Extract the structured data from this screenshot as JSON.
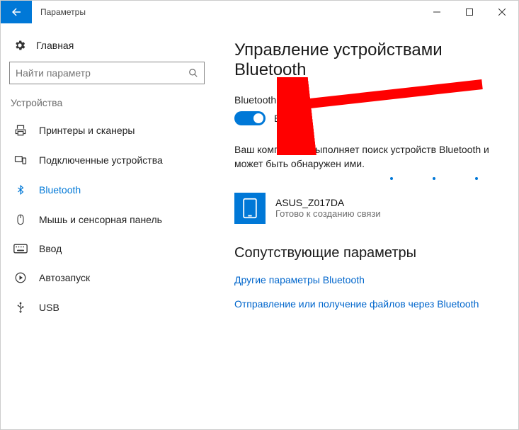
{
  "titlebar": {
    "title": "Параметры"
  },
  "sidebar": {
    "home": "Главная",
    "search_placeholder": "Найти параметр",
    "group": "Устройства",
    "items": [
      {
        "label": "Принтеры и сканеры"
      },
      {
        "label": "Подключенные устройства"
      },
      {
        "label": "Bluetooth"
      },
      {
        "label": "Мышь и сенсорная панель"
      },
      {
        "label": "Ввод"
      },
      {
        "label": "Автозапуск"
      },
      {
        "label": "USB"
      }
    ]
  },
  "main": {
    "heading": "Управление устройствами Bluetooth",
    "bt_label": "Bluetooth",
    "toggle_state_label": "Вкл.",
    "description": "Ваш компьютер выполняет поиск устройств Bluetooth и может быть обнаружен ими.",
    "device": {
      "name": "ASUS_Z017DA",
      "status": "Готово к созданию связи"
    },
    "related_heading": "Сопутствующие параметры",
    "link1": "Другие параметры Bluetooth",
    "link2": "Отправление или получение файлов через Bluetooth"
  }
}
